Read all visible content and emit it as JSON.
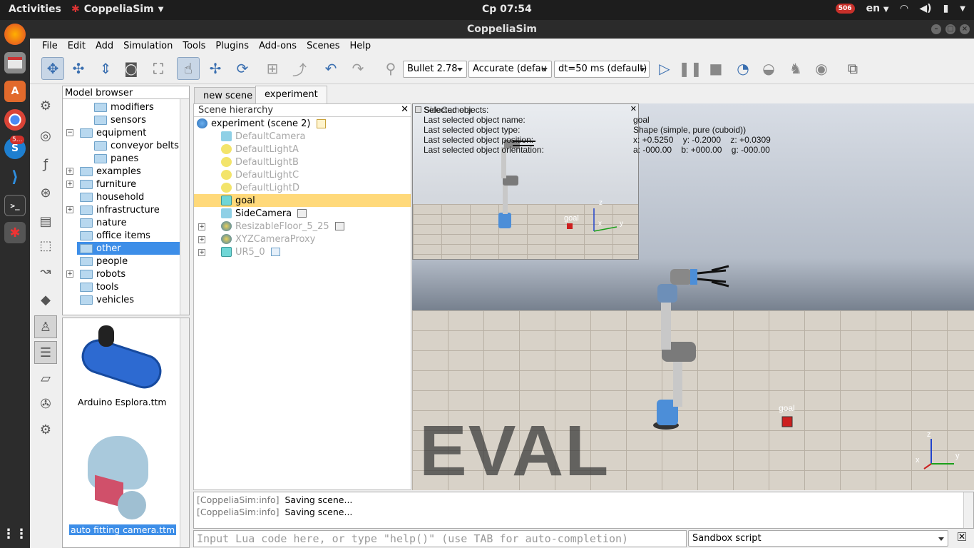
{
  "topbar": {
    "activities": "Activities",
    "app_menu": "CoppeliaSim",
    "clock": "Cp 07:54",
    "notification_count": "506",
    "language": "en"
  },
  "dock": {
    "badge": "5..."
  },
  "window": {
    "title": "CoppeliaSim"
  },
  "menubar": [
    "File",
    "Edit",
    "Add",
    "Simulation",
    "Tools",
    "Plugins",
    "Add-ons",
    "Scenes",
    "Help"
  ],
  "toolbar": {
    "engine": "Bullet 2.78",
    "accuracy": "Accurate (defau",
    "timestep": "dt=50 ms (default)"
  },
  "model_browser": {
    "title": "Model browser",
    "items": [
      "modifiers",
      "sensors",
      "equipment",
      "conveyor belts",
      "panes",
      "examples",
      "furniture",
      "household",
      "infrastructure",
      "nature",
      "office items",
      "other",
      "people",
      "robots",
      "tools",
      "vehicles"
    ],
    "thumbnails": [
      "Arduino Esplora.ttm",
      "auto fitting camera.ttm"
    ]
  },
  "tabs": [
    "new scene",
    "experiment"
  ],
  "hierarchy": {
    "title": "Scene hierarchy",
    "root": "experiment (scene 2)",
    "items": [
      "DefaultCamera",
      "DefaultLightA",
      "DefaultLightB",
      "DefaultLightC",
      "DefaultLightD",
      "goal",
      "SideCamera",
      "ResizableFloor_5_25",
      "XYZCameraProxy",
      "UR5_0"
    ]
  },
  "viewport": {
    "inset_title": "SideCamera",
    "info_title": "Selected objects:",
    "info_labels": [
      "Last selected object name:",
      "Last selected object type:",
      "Last selected object position:",
      "Last selected object orientation:"
    ],
    "info_values": [
      "goal",
      "Shape (simple, pure (cuboid))",
      "x: +0.5250    y: -0.2000    z: +0.0309",
      "a: -000.00    b: +000.00    g: -000.00"
    ],
    "goal_label": "goal",
    "watermark": "EVAL",
    "axis_labels": [
      "z",
      "x",
      "y"
    ]
  },
  "console": {
    "lines": [
      {
        "tag": "[CoppeliaSim:info]",
        "msg": "Saving scene..."
      },
      {
        "tag": "[CoppeliaSim:info]",
        "msg": "Saving scene..."
      }
    ]
  },
  "lua": {
    "placeholder": "Input Lua code here, or type \"help()\" (use TAB for auto-completion)",
    "script_select": "Sandbox script"
  }
}
